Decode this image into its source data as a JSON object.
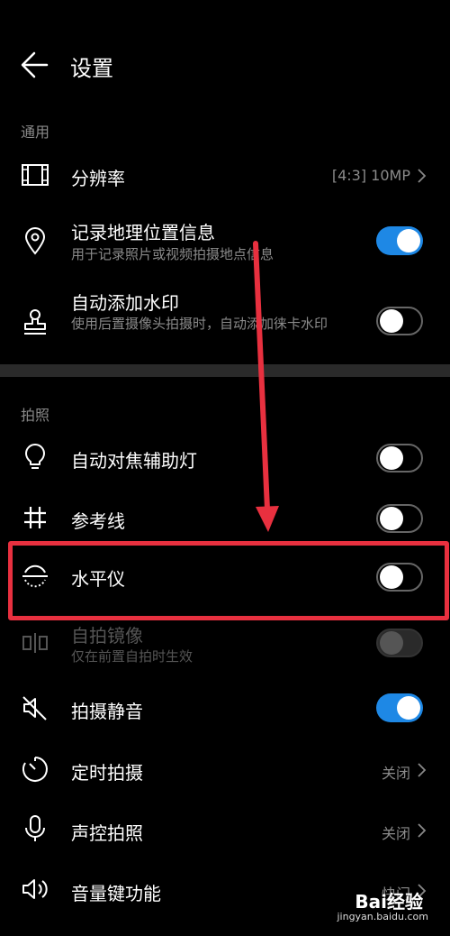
{
  "header": {
    "title": "设置"
  },
  "sections": {
    "general": "通用",
    "photo": "拍照"
  },
  "rows": {
    "resolution": {
      "label": "分辨率",
      "value": "[4:3] 10MP"
    },
    "geo": {
      "label": "记录地理位置信息",
      "sub": "用于记录照片或视频拍摄地点信息",
      "toggle": "on"
    },
    "watermark": {
      "label": "自动添加水印",
      "sub": "使用后置摄像头拍摄时，自动添加徕卡水印",
      "toggle": "off"
    },
    "focus_light": {
      "label": "自动对焦辅助灯",
      "toggle": "off"
    },
    "grid": {
      "label": "参考线",
      "toggle": "off"
    },
    "level": {
      "label": "水平仪",
      "toggle": "off"
    },
    "mirror": {
      "label": "自拍镜像",
      "sub": "仅在前置自拍时生效",
      "toggle": "disabled"
    },
    "mute": {
      "label": "拍摄静音",
      "toggle": "on"
    },
    "timer": {
      "label": "定时拍摄",
      "value": "关闭"
    },
    "voice": {
      "label": "声控拍照",
      "value": "关闭"
    },
    "volume": {
      "label": "音量键功能",
      "value": "快门"
    }
  },
  "watermark_brand": {
    "logo": "Bai经验",
    "url": "jingyan.baidu.com"
  },
  "colors": {
    "accent": "#1e88e5",
    "annotation": "#e8303f"
  }
}
